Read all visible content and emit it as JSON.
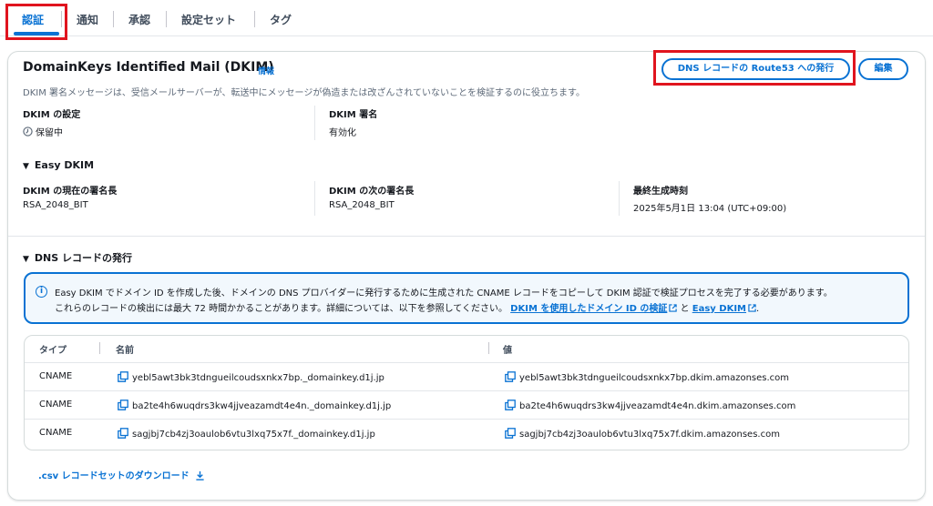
{
  "tabs": [
    {
      "label": "認証",
      "active": true
    },
    {
      "label": "通知",
      "active": false
    },
    {
      "label": "承認",
      "active": false
    },
    {
      "label": "設定セット",
      "active": false
    },
    {
      "label": "タグ",
      "active": false
    }
  ],
  "header": {
    "title": "DomainKeys Identified Mail (DKIM)",
    "info": "情報",
    "description": "DKIM 署名メッセージは、受信メールサーバーが、転送中にメッセージが偽造または改ざんされていないことを検証するのに役立ちます。",
    "publish_button": "DNS レコードの Route53 への発行",
    "edit_button": "編集"
  },
  "dkim": {
    "settings_label": "DKIM の設定",
    "settings_value": "保留中",
    "signing_label": "DKIM 署名",
    "signing_value": "有効化"
  },
  "easy_dkim": {
    "heading": "Easy DKIM",
    "current_label": "DKIM の現在の署名長",
    "current_value": "RSA_2048_BIT",
    "next_label": "DKIM の次の署名長",
    "next_value": "RSA_2048_BIT",
    "generated_label": "最終生成時刻",
    "generated_value": "2025年5月1日 13:04 (UTC+09:00)"
  },
  "dns": {
    "heading": "DNS レコードの発行",
    "alert_line1": "Easy DKIM でドメイン ID を作成した後、ドメインの DNS プロバイダーに発行するために生成された CNAME レコードをコピーして DKIM 認証で検証プロセスを完了する必要があります。",
    "alert_line2_prefix": "これらのレコードの検出には最大 72 時間かかることがあります。詳細については、以下を参照してください。",
    "alert_link1": "DKIM を使用したドメイン ID の検証",
    "alert_and": "と",
    "alert_link2": "Easy DKIM",
    "alert_end": ".",
    "columns": [
      "タイプ",
      "名前",
      "値"
    ],
    "rows": [
      {
        "type": "CNAME",
        "name": "yebl5awt3bk3tdngueilcoudsxnkx7bp._domainkey.d1j.jp",
        "value": "yebl5awt3bk3tdngueilcoudsxnkx7bp.dkim.amazonses.com"
      },
      {
        "type": "CNAME",
        "name": "ba2te4h6wuqdrs3kw4jjveazamdt4e4n._domainkey.d1j.jp",
        "value": "ba2te4h6wuqdrs3kw4jjveazamdt4e4n.dkim.amazonses.com"
      },
      {
        "type": "CNAME",
        "name": "sagjbj7cb4zj3oaulob6vtu3lxq75x7f._domainkey.d1j.jp",
        "value": "sagjbj7cb4zj3oaulob6vtu3lxq75x7f.dkim.amazonses.com"
      }
    ],
    "download_label": ".csv レコードセットのダウンロード"
  },
  "colors": {
    "accent": "#0972d3",
    "highlight": "#e0141e"
  }
}
